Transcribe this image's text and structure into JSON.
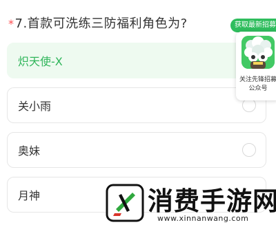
{
  "question": {
    "required_mark": "*",
    "text": "7.首款可洗练三防福利角色为?"
  },
  "options": [
    {
      "label": "炽天使-X",
      "selected": true
    },
    {
      "label": "关小雨",
      "selected": false
    },
    {
      "label": "奥妹",
      "selected": false
    },
    {
      "label": "月神",
      "selected": false
    }
  ],
  "promo": {
    "pill_label": "获取最新招募",
    "line1": "关注先锋招募",
    "line2": "公众号"
  },
  "watermark": {
    "title": "消费手游网",
    "url": "www.xinnanwang.com"
  },
  "colors": {
    "accent_green": "#2fb55a",
    "selected_bg": "#eefaf0",
    "required_red": "#ff4d4f"
  }
}
